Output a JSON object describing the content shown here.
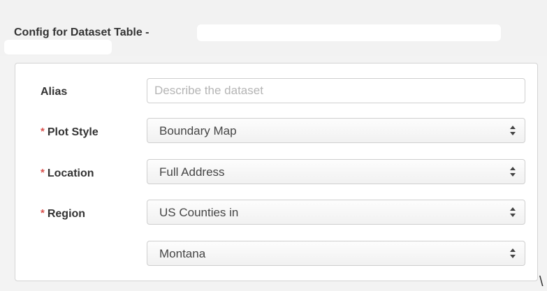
{
  "header": {
    "title": "Config for Dataset Table - "
  },
  "form": {
    "alias": {
      "label": "Alias",
      "placeholder": "Describe the dataset",
      "value": ""
    },
    "plot_style": {
      "label": "Plot Style",
      "required_mark": "*",
      "value": "Boundary Map"
    },
    "location": {
      "label": "Location",
      "required_mark": "*",
      "value": "Full Address"
    },
    "region": {
      "label": "Region",
      "required_mark": "*",
      "value": "US Counties in"
    },
    "state": {
      "value": "Montana"
    }
  },
  "stray_text": "\\",
  "colors": {
    "required": "#d9534f",
    "border": "#cfcfcf",
    "background": "#f3f3f3"
  }
}
